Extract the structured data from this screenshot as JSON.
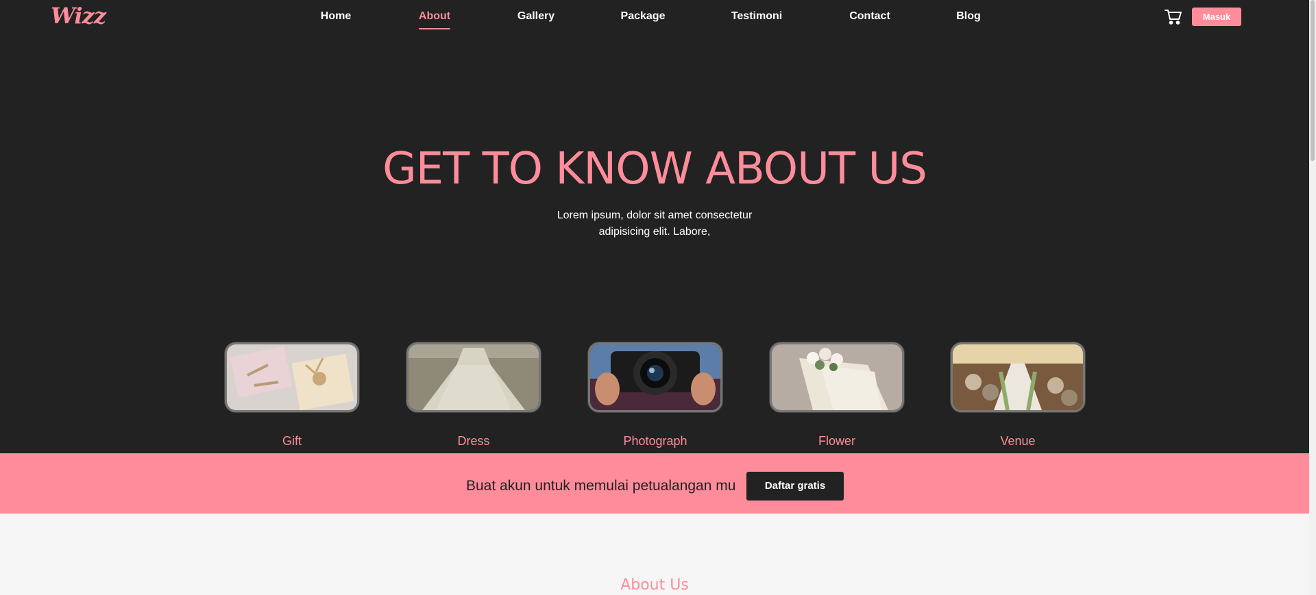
{
  "brand": {
    "logo": "Wizz",
    "accent_color": "#ff8c9a",
    "dark_bg": "#222222"
  },
  "nav": {
    "links": [
      "Home",
      "About",
      "Gallery",
      "Package",
      "Testimoni",
      "Contact",
      "Blog"
    ],
    "active": "About",
    "cart_icon": "cart-icon",
    "login_label": "Masuk"
  },
  "hero": {
    "title": "GET TO KNOW ABOUT US",
    "subtitle_line1": "Lorem ipsum, dolor sit amet consectetur",
    "subtitle_line2": "adipisicing elit. Labore,"
  },
  "services": [
    {
      "label": "Gift"
    },
    {
      "label": "Dress"
    },
    {
      "label": "Photograph"
    },
    {
      "label": "Flower"
    },
    {
      "label": "Venue"
    }
  ],
  "cta": {
    "text": "Buat akun untuk memulai petualangan mu",
    "button": "Daftar gratis"
  },
  "about": {
    "title": "About Us"
  }
}
